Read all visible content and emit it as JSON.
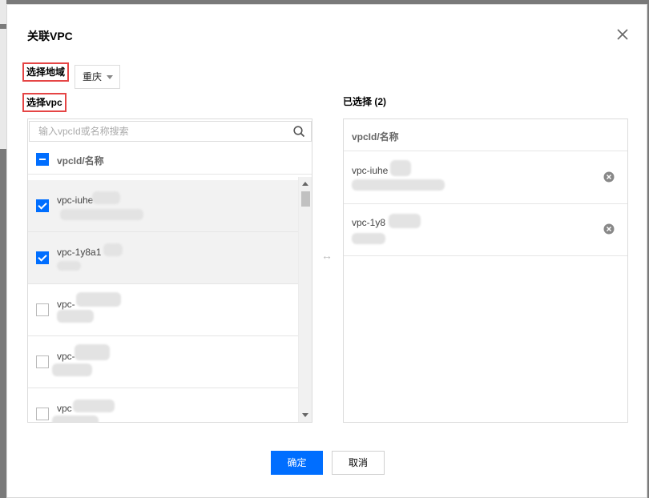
{
  "dialog": {
    "title": "关联VPC"
  },
  "region": {
    "label": "选择地域",
    "value": "重庆"
  },
  "vpc": {
    "label": "选择vpc",
    "search_placeholder": "输入vpcId或名称搜索",
    "header": "vpcId/名称"
  },
  "rows": [
    {
      "name": "vpc-iuhe",
      "checked": true
    },
    {
      "name": "vpc-1y8a1",
      "checked": true
    },
    {
      "name": "vpc-",
      "checked": false
    },
    {
      "name": "vpc-",
      "checked": false
    },
    {
      "name": "vpc",
      "checked": false
    }
  ],
  "selected": {
    "title": "已选择 (2)",
    "header": "vpcId/名称",
    "items": [
      {
        "name": "vpc-iuhe"
      },
      {
        "name": "vpc-1y8"
      }
    ]
  },
  "transfer_icon": "↔",
  "buttons": {
    "confirm": "确定",
    "cancel": "取消"
  },
  "icons": {
    "close": "close-icon",
    "search": "search-icon",
    "remove": "remove-circle-icon",
    "transfer": "transfer-arrows-icon"
  },
  "colors": {
    "primary": "#006eff",
    "annotation": "#e54545"
  }
}
